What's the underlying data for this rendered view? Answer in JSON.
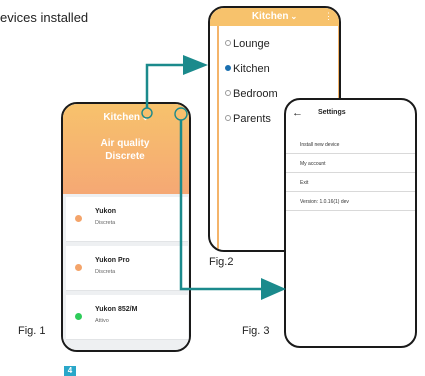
{
  "header": {
    "top_fragment": "",
    "text": "evices installed"
  },
  "phone1": {
    "title": "Kitchen",
    "air_quality_line1": "Air quality",
    "air_quality_line2": "Discrete",
    "devices": [
      {
        "name": "Yukon",
        "status": "Discreta",
        "dot_color": "#f4a46a"
      },
      {
        "name": "Yukon Pro",
        "status": "Discreta",
        "dot_color": "#f4a46a"
      },
      {
        "name": "Yukon 852/M",
        "status": "Attivo",
        "dot_color": "#2ecc5a"
      }
    ]
  },
  "phone2": {
    "title": "Kitchen",
    "rooms": [
      {
        "label": "Lounge",
        "selected": false
      },
      {
        "label": "Kitchen",
        "selected": true
      },
      {
        "label": "Bedroom",
        "selected": false
      },
      {
        "label": "Parents",
        "selected": false
      }
    ]
  },
  "phone3": {
    "title": "Settings",
    "items": [
      "Install new device",
      "My account",
      "Exit",
      "Version: 1.0.16(1) dev"
    ]
  },
  "captions": {
    "fig1": "Fig. 1",
    "fig2": "Fig.2",
    "fig3": "Fig. 3"
  },
  "badge": "4",
  "colors": {
    "accent_orange": "#f7c26c",
    "connector_teal": "#1b8a8c",
    "badge_blue": "#2aa7c9"
  },
  "icons": [
    "chevron-down-icon",
    "more-vert-icon",
    "back-arrow-icon",
    "radio-dot-icon",
    "connector-arrow-icon"
  ]
}
